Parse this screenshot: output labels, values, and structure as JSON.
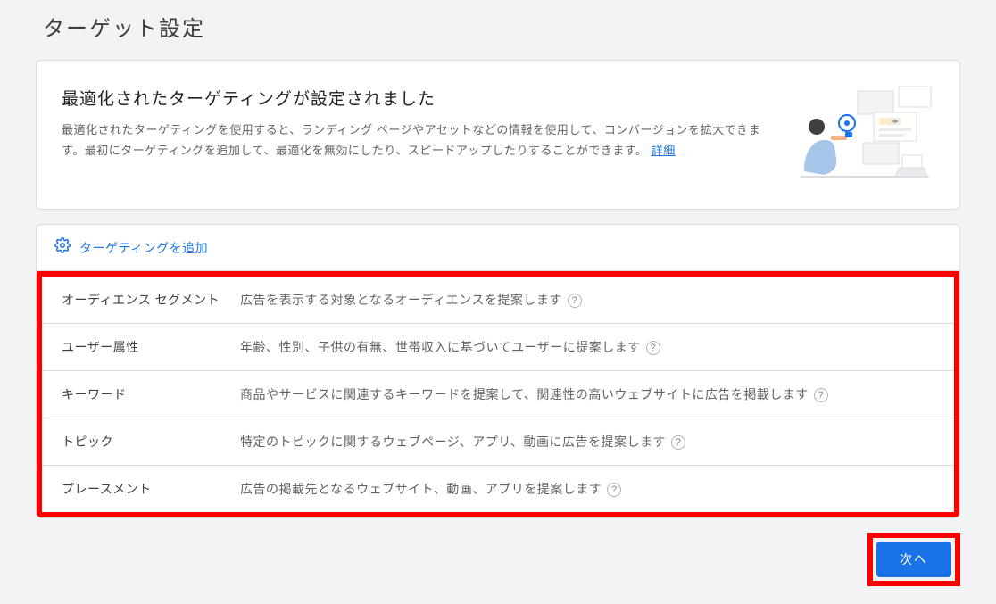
{
  "title": "ターゲット設定",
  "info_card": {
    "heading": "最適化されたターゲティングが設定されました",
    "description_pre": "最適化されたターゲティングを使用すると、ランディング ページやアセットなどの情報を使用して、コンバージョンを拡大できます。最初にターゲティングを追加して、最適化を無効にしたり、スピードアップしたりすることができます。 ",
    "link_label": "詳細"
  },
  "add_targeting_label": "ターゲティングを追加",
  "rows": [
    {
      "label": "オーディエンス セグメント",
      "desc": "広告を表示する対象となるオーディエンスを提案します"
    },
    {
      "label": "ユーザー属性",
      "desc": "年齢、性別、子供の有無、世帯収入に基づいてユーザーに提案します"
    },
    {
      "label": "キーワード",
      "desc": "商品やサービスに関連するキーワードを提案して、関連性の高いウェブサイトに広告を掲載します"
    },
    {
      "label": "トピック",
      "desc": "特定のトピックに関するウェブページ、アプリ、動画に広告を提案します"
    },
    {
      "label": "プレースメント",
      "desc": "広告の掲載先となるウェブサイト、動画、アプリを提案します"
    }
  ],
  "next_button": "次へ"
}
